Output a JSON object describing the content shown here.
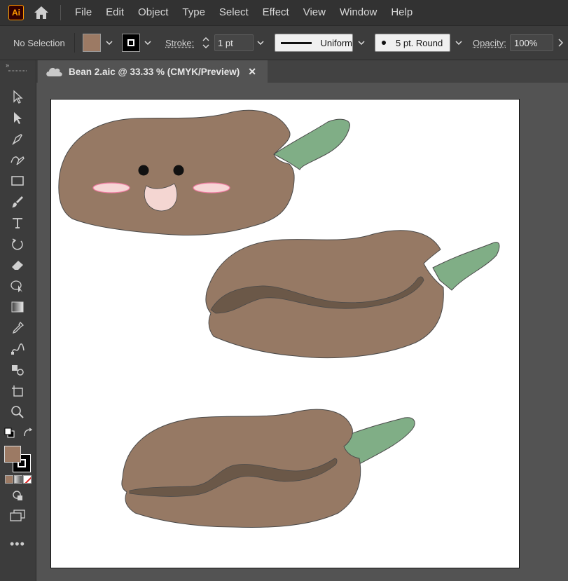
{
  "app": {
    "logo_text": "Ai"
  },
  "menu": [
    "File",
    "Edit",
    "Object",
    "Type",
    "Select",
    "Effect",
    "View",
    "Window",
    "Help"
  ],
  "control": {
    "selection": "No Selection",
    "stroke_label": "Stroke:",
    "stroke_value": "1 pt",
    "profile": "Uniform",
    "brush": "5 pt. Round",
    "opacity_label": "Opacity:",
    "opacity_value": "100%",
    "fill_color": "#9c7a64",
    "stroke_color": "#000000"
  },
  "document": {
    "tab_title": "Bean 2.aic @ 33.33 % (CMYK/Preview)"
  },
  "colors": {
    "bean": "#967964",
    "bean_outline": "#4a4a4a",
    "sprout": "#80ae86",
    "crease": "#6b5848",
    "blush": "#f6d6d6",
    "blush_outline": "#f07aa0",
    "mouth": "#f4d6d2",
    "eyes": "#111111"
  },
  "tools": [
    "selection-tool-icon",
    "direct-selection-tool-icon",
    "pen-tool-icon",
    "curvature-tool-icon",
    "rectangle-tool-icon",
    "paintbrush-tool-icon",
    "type-tool-icon",
    "rotate-tool-icon",
    "eraser-tool-icon",
    "shape-builder-tool-icon",
    "gradient-tool-icon",
    "eyedropper-tool-icon",
    "blend-tool-icon",
    "symbol-sprayer-tool-icon",
    "artboard-tool-icon",
    "zoom-tool-icon"
  ]
}
